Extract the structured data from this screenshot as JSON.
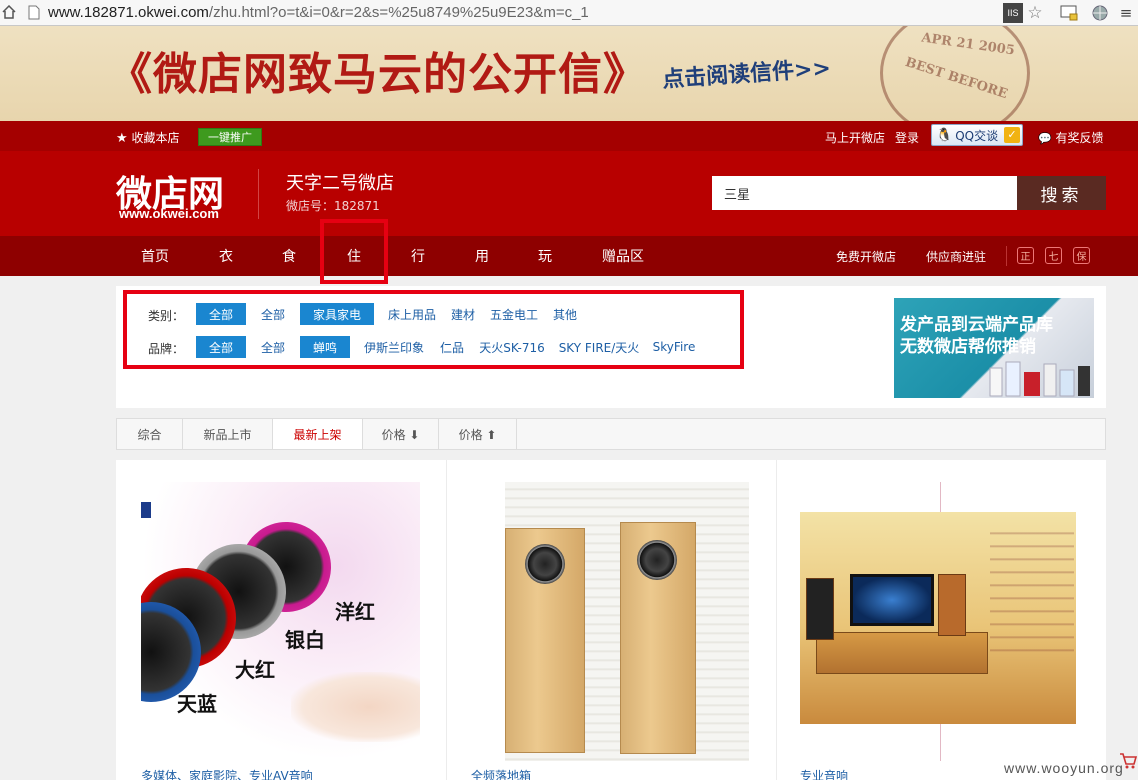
{
  "browser": {
    "url": "www.182871.okwei.com/zhu.html?o=t&i=0&r=2&s=%25u8749%25u9E23&m=c_1",
    "url_host": "www.182871.okwei.com",
    "url_path": "/zhu.html?o=t&i=0&r=2&s=%25u8749%25u9E23&m=c_1",
    "ext_label": "IIS"
  },
  "banner": {
    "title": "《微店网致马云的公开信》",
    "cta": "点击阅读信件>>",
    "stamp_date": "APR 21 2005",
    "stamp_text": "BEST BEFORE"
  },
  "topbar": {
    "bookmark": "收藏本店",
    "promote": "一键推广",
    "open_shop": "马上开微店",
    "login": "登录",
    "qq": "QQ交谈",
    "feedback": "有奖反馈"
  },
  "header": {
    "logo": "微店网",
    "logo_sub": "www.okwei.com",
    "shop_name": "天字二号微店",
    "shop_no": "微店号：182871",
    "search_value": "三星",
    "search_btn": "搜索"
  },
  "nav": {
    "items": [
      "首页",
      "衣",
      "食",
      "住",
      "行",
      "用",
      "玩",
      "赠品区"
    ],
    "right": [
      "免费开微店",
      "供应商进驻"
    ],
    "badges": [
      "正",
      "七",
      "保"
    ]
  },
  "filter": {
    "category_label": "类别：",
    "category_opts": [
      "全部",
      "全部",
      "家具家电",
      "床上用品",
      "建材",
      "五金电工",
      "其他"
    ],
    "brand_label": "品牌：",
    "brand_opts": [
      "全部",
      "全部",
      "蝉鸣",
      "伊斯兰印象",
      "仁品",
      "天火SK-716",
      "SKY FIRE/天火",
      "SkyFire"
    ],
    "ad_line1": "发产品到云端产品库",
    "ad_line2": "无数微店帮你推销"
  },
  "sort": {
    "items": [
      "综合",
      "新品上市",
      "最新上架",
      "价格 ⬇",
      "价格 ⬆"
    ]
  },
  "products": [
    {
      "title": "多媒体、家庭影院、专业AV音响",
      "colors": [
        "洋红",
        "银白",
        "大红",
        "天蓝"
      ]
    },
    {
      "title": "全频落地箱"
    },
    {
      "title": "专业音响"
    }
  ],
  "watermark": "www.wooyun.org",
  "colors": {
    "header_red": "#b80000",
    "nav_red": "#8e0000",
    "select_blue": "#1a86d0",
    "highlight": "#e60012"
  }
}
